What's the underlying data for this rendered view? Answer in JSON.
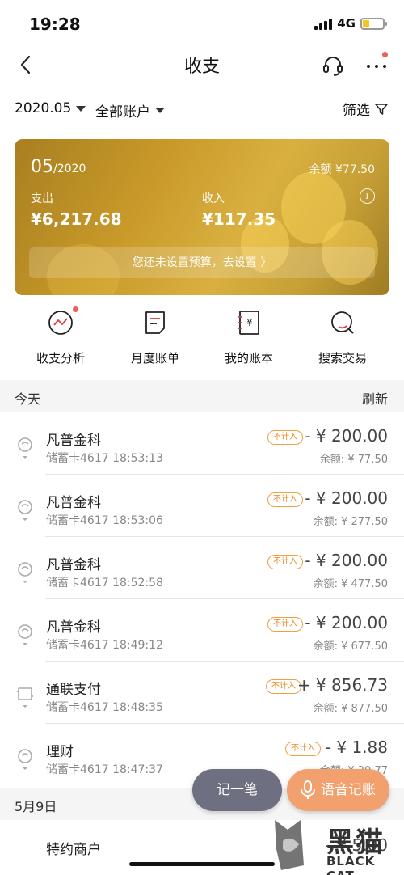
{
  "status_bar": {
    "time": "19:28",
    "network": "4G"
  },
  "nav": {
    "title": "收支"
  },
  "filter": {
    "date": "2020.05",
    "account": "全部账户",
    "filter_label": "筛选"
  },
  "summary_card": {
    "month": "05",
    "year": "/2020",
    "balance": "余额  ¥77.50",
    "expense_label": "支出",
    "expense_amount": "¥6,217.68",
    "income_label": "收入",
    "income_amount": "¥117.35",
    "budget_prompt": "您还未设置预算，去设置  〉"
  },
  "quick_actions": [
    {
      "label": "收支分析",
      "icon": "chart-icon",
      "has_dot": true
    },
    {
      "label": "月度账单",
      "icon": "bill-icon",
      "has_dot": false
    },
    {
      "label": "我的账本",
      "icon": "ledger-icon",
      "has_dot": false
    },
    {
      "label": "搜索交易",
      "icon": "search-icon",
      "has_dot": false
    }
  ],
  "sections": {
    "today": {
      "label": "今天",
      "action": "刷新"
    },
    "may9": {
      "label": "5月9日"
    }
  },
  "transactions": [
    {
      "name": "凡普金科",
      "detail": "储蓄卡4617 18:53:13",
      "badge": "不计入",
      "amount": "- ¥ 200.00",
      "balance": "余额: ¥ 77.50",
      "icon": "wallet-icon"
    },
    {
      "name": "凡普金科",
      "detail": "储蓄卡4617 18:53:06",
      "badge": "不计入",
      "amount": "- ¥ 200.00",
      "balance": "余额: ¥ 277.50",
      "icon": "wallet-icon"
    },
    {
      "name": "凡普金科",
      "detail": "储蓄卡4617 18:52:58",
      "badge": "不计入",
      "amount": "- ¥ 200.00",
      "balance": "余额: ¥ 477.50",
      "icon": "wallet-icon"
    },
    {
      "name": "凡普金科",
      "detail": "储蓄卡4617 18:49:12",
      "badge": "不计入",
      "amount": "- ¥ 200.00",
      "balance": "余额: ¥ 677.50",
      "icon": "wallet-icon"
    },
    {
      "name": "通联支付",
      "detail": "储蓄卡4617 18:48:35",
      "badge": "不计入",
      "amount": "+ ¥ 856.73",
      "balance": "余额: ¥ 877.50",
      "icon": "transfer-icon"
    },
    {
      "name": "理财",
      "detail": "储蓄卡4617 18:47:37",
      "badge": "不计入",
      "amount": "- ¥ 1.88",
      "balance": "余额: ¥ 20.77",
      "icon": "wallet-icon"
    }
  ],
  "next_transaction": {
    "name": "特约商户",
    "amount": "- ¥ 5.00"
  },
  "fab": {
    "record_label": "记一笔",
    "voice_label": "语音记账"
  },
  "watermark": {
    "text": "黑猫",
    "sub": "BLACK CAT"
  },
  "colors": {
    "accent_orange": "#f2a06e",
    "badge_orange": "#e88a20",
    "card_gold": "#c99a2a",
    "notification_red": "#f25c54"
  }
}
